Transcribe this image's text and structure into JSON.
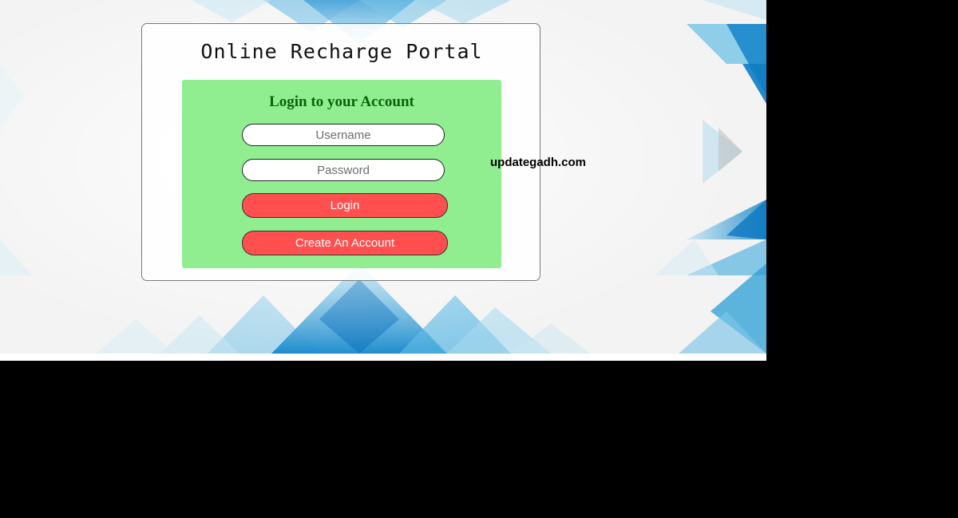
{
  "page": {
    "title": "Online Recharge Portal",
    "watermark": "updategadh.com"
  },
  "login": {
    "heading": "Login to your Account",
    "username_placeholder": "Username",
    "password_placeholder": "Password",
    "login_label": "Login",
    "create_label": "Create An Account"
  },
  "colors": {
    "login_box": "#90ee90",
    "heading_text": "#0b610b",
    "button": "#ff4f4f",
    "background_accent": "#2a9fd6"
  },
  "icons": [
    "background-triangle-pattern"
  ]
}
